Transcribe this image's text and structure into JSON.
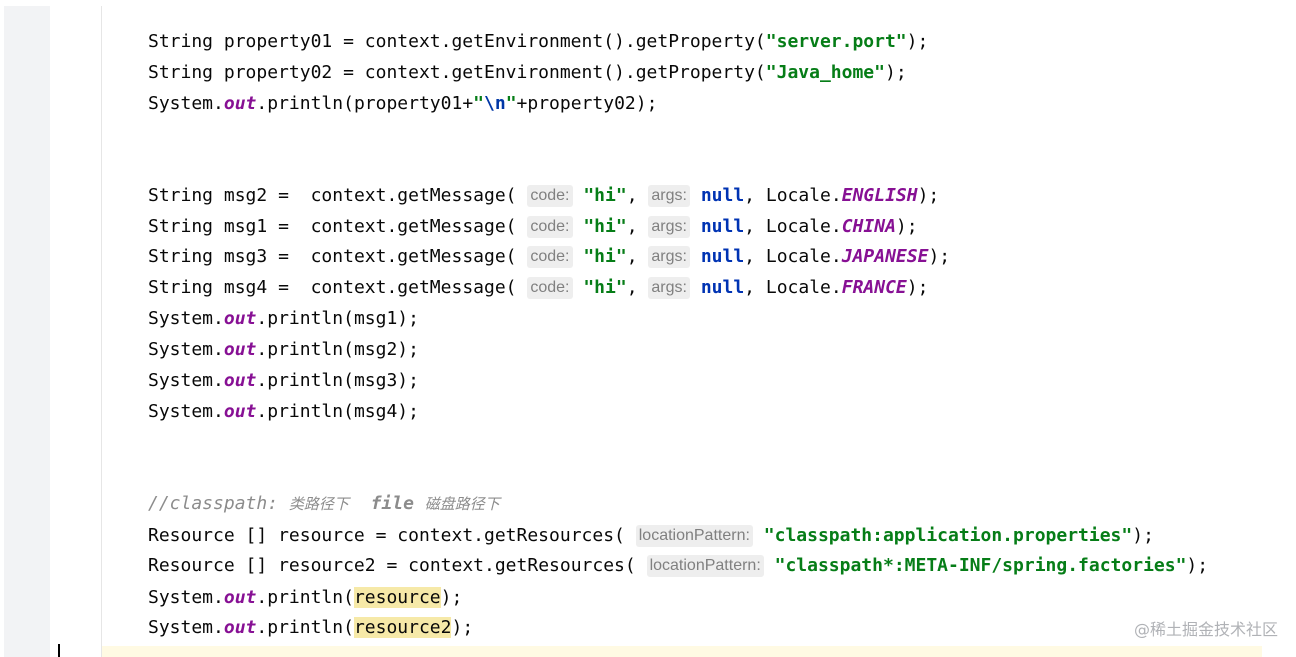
{
  "editor": {
    "tokens": {
      "string": "String",
      "resource_type": "Resource",
      "array_brackets": "[]",
      "system": "System",
      "out": "out",
      "println": "println",
      "context": "context",
      "getEnvironment": "getEnvironment",
      "getProperty": "getProperty",
      "getMessage": "getMessage",
      "getResources": "getResources",
      "locale": "Locale",
      "null_kw": "null",
      "newline_escape": "\\n"
    },
    "variables": {
      "property01": "property01",
      "property02": "property02",
      "msg1": "msg1",
      "msg2": "msg2",
      "msg3": "msg3",
      "msg4": "msg4",
      "resource": "resource",
      "resource2": "resource2"
    },
    "strings": {
      "server_port": "\"server.port\"",
      "java_home": "\"Java_home\"",
      "hi": "\"hi\"",
      "classpath_props": "\"classpath:application.properties\"",
      "classpath_factories": "\"classpath*:META-INF/spring.factories\""
    },
    "locales": {
      "english": "ENGLISH",
      "china": "CHINA",
      "japanese": "JAPANESE",
      "france": "FRANCE"
    },
    "hints": {
      "code": "code:",
      "args": "args:",
      "location_pattern": "locationPattern:"
    },
    "comment": {
      "prefix": "//classpath: ",
      "part1": "类路径下",
      "file": "file",
      "part2": "磁盘路径下"
    }
  },
  "watermark": "@稀土掘金技术社区"
}
